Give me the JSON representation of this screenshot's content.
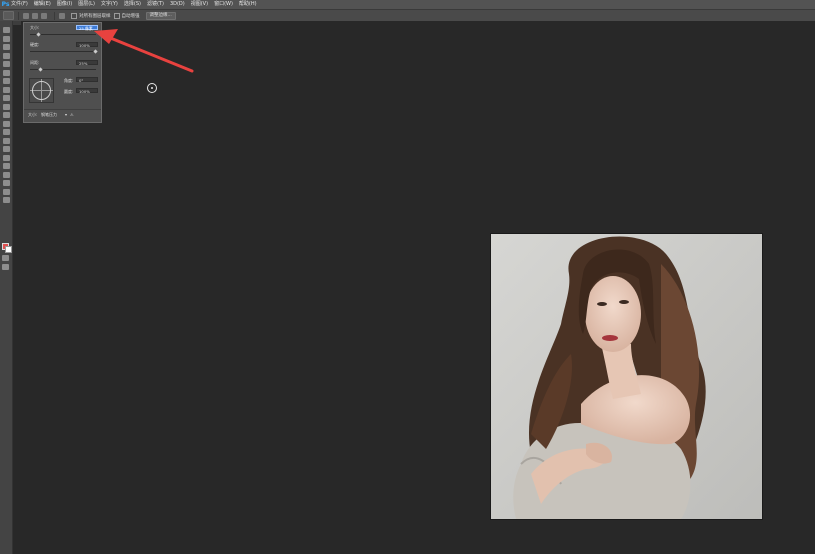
{
  "app": {
    "logo": "Ps"
  },
  "menubar": {
    "items": [
      "文件(F)",
      "编辑(E)",
      "图像(I)",
      "图层(L)",
      "文字(Y)",
      "选择(S)",
      "滤镜(T)",
      "3D(D)",
      "视图(V)",
      "窗口(W)",
      "帮助(H)"
    ]
  },
  "options": {
    "check1_label": "对所有图层取样",
    "check2_label": "自动增强",
    "refine_button": "调整边缘..."
  },
  "brush_panel": {
    "size_label": "大小:",
    "size_value": "25 像素",
    "hardness_label": "硬度:",
    "hardness_value": "100%",
    "spacing_label": "间距:",
    "spacing_value": "25%",
    "angle_label": "角度:",
    "angle_value": "0°",
    "roundness_label": "圆度:",
    "roundness_value": "100%",
    "size_mode_label": "大小:",
    "size_mode_value": "钢笔压力"
  },
  "colors": {
    "arrow": "#e8423f",
    "selection_field": "#3d7bd6",
    "canvas_bg": "#282828"
  }
}
